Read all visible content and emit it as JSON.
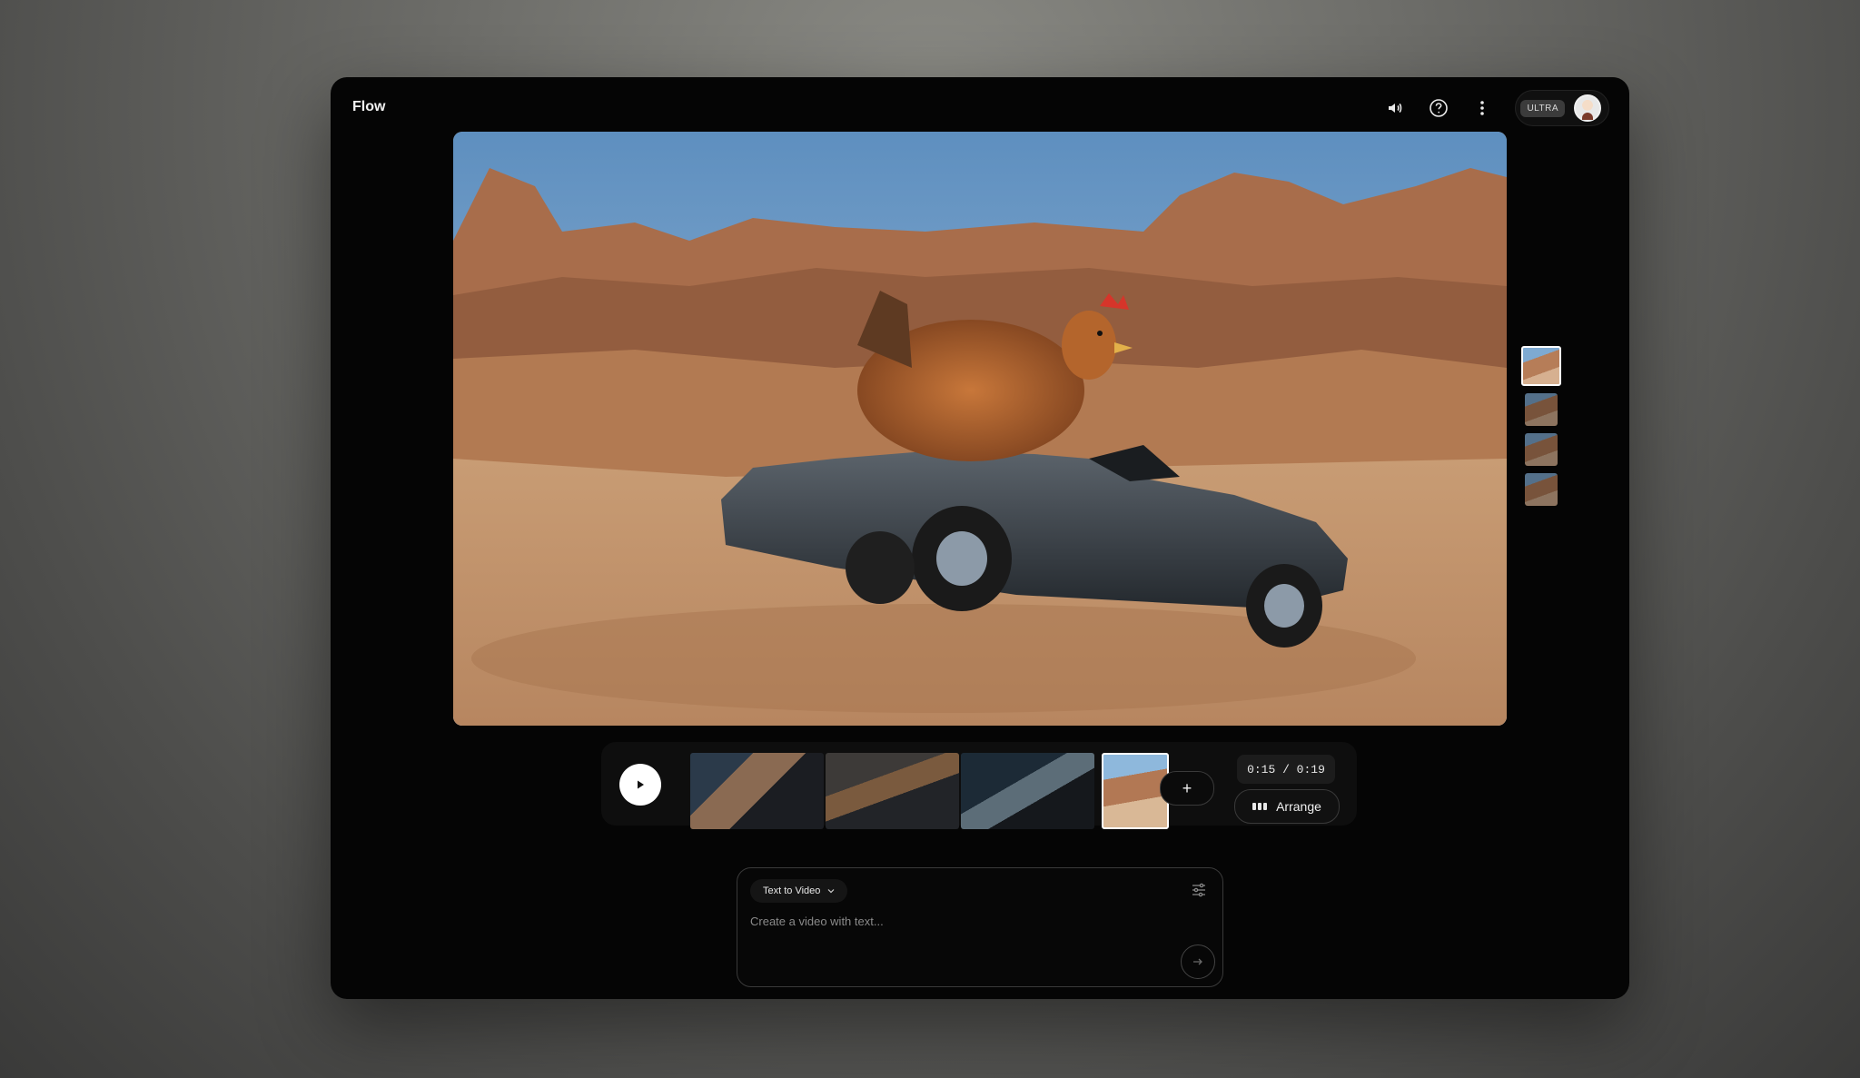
{
  "app": {
    "title": "Flow"
  },
  "header": {
    "icons": [
      "volume-icon",
      "help-icon",
      "more-vert-icon"
    ],
    "plan_badge": "ULTRA"
  },
  "player": {
    "time_current": "0:15",
    "time_total": "0:19",
    "time_display": "0:15 / 0:19",
    "add_label": "+",
    "arrange_label": "Arrange"
  },
  "prompt": {
    "mode_label": "Text to Video",
    "placeholder": "Create a video with text..."
  },
  "colors": {
    "frame_bg": "#050505",
    "accent_white": "#ffffff",
    "border": "#3a3a3a"
  }
}
